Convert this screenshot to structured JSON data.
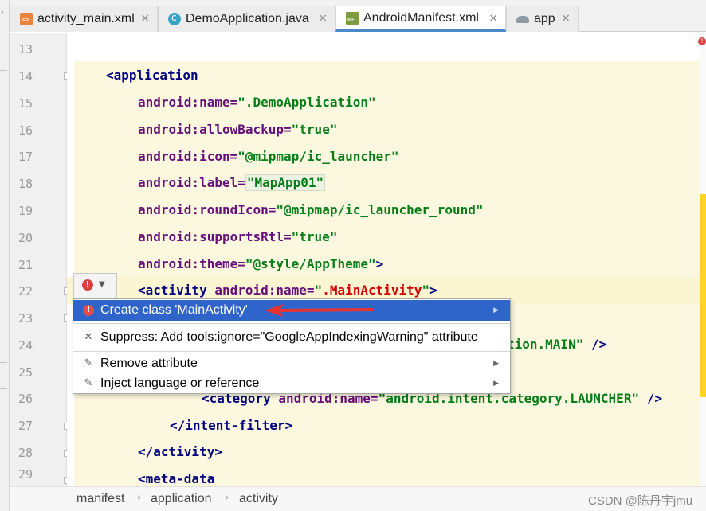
{
  "tabs": [
    {
      "label": "activity_main.xml",
      "icon": "xml-file-icon",
      "close": "×"
    },
    {
      "label": "DemoApplication.java",
      "icon": "java-class-icon",
      "close": "×"
    },
    {
      "label": "AndroidManifest.xml",
      "icon": "manifest-file-icon",
      "close": "×"
    },
    {
      "label": "app",
      "icon": "gradle-icon",
      "close": "×"
    }
  ],
  "line_numbers": [
    "13",
    "14",
    "15",
    "16",
    "17",
    "18",
    "19",
    "20",
    "21",
    "22",
    "23",
    "24",
    "25",
    "26",
    "27",
    "28",
    "29"
  ],
  "code": {
    "l14_tag": "<application",
    "l15_attr": "android:name=",
    "l15_val": "\".DemoApplication\"",
    "l16_attr": "android:allowBackup=",
    "l16_val": "\"true\"",
    "l17_attr": "android:icon=",
    "l17_val": "\"@mipmap/ic_launcher\"",
    "l18_attr": "android:label=",
    "l18_val": "\"MapApp01\"",
    "l19_attr": "android:roundIcon=",
    "l19_val": "\"@mipmap/ic_launcher_round\"",
    "l20_attr": "android:supportsRtl=",
    "l20_val": "\"true\"",
    "l21_attr": "android:theme=",
    "l21_val": "\"@style/AppTheme\"",
    "l21_end": ">",
    "l22_tag": "<activity ",
    "l22_attr": "android:name=",
    "l22_q1": "\"",
    "l22_val": ".MainActivity",
    "l22_q2": "\"",
    "l22_end": ">",
    "l24_tail_val": "tion.MAIN\"",
    "l24_tail_end": " />",
    "l26_tag": "<category ",
    "l26_attr": "android:name=",
    "l26_val": "\"android.intent.category.LAUNCHER\"",
    "l26_end": " />",
    "l27_tag": "</intent-filter>",
    "l28_tag": "</activity>",
    "l29_tag": "<meta-data"
  },
  "popup": {
    "items": [
      {
        "label": "Create class 'MainActivity'",
        "icon": "error-bulb-icon",
        "arrow": "▶",
        "selected": true
      },
      {
        "label": "Suppress: Add tools:ignore=\"GoogleAppIndexingWarning\" attribute",
        "icon": "close-icon",
        "arrow": ""
      },
      {
        "label": "Remove attribute",
        "icon": "edit-intention-icon",
        "arrow": "▶"
      },
      {
        "label": "Inject language or reference",
        "icon": "edit-intention-icon",
        "arrow": "▶"
      }
    ]
  },
  "bulb": {
    "icon": "!",
    "dropdown": "▼"
  },
  "breadcrumb": [
    "manifest",
    "application",
    "activity"
  ],
  "breadcrumb_sep": "›",
  "watermark": "CSDN @陈丹宇jmu",
  "colors": {
    "tag": "#000080",
    "attr": "#660e7a",
    "value": "#067d17",
    "error": "#d00000",
    "selection": "#2f65ca",
    "highlight": "#fcf8e0"
  }
}
